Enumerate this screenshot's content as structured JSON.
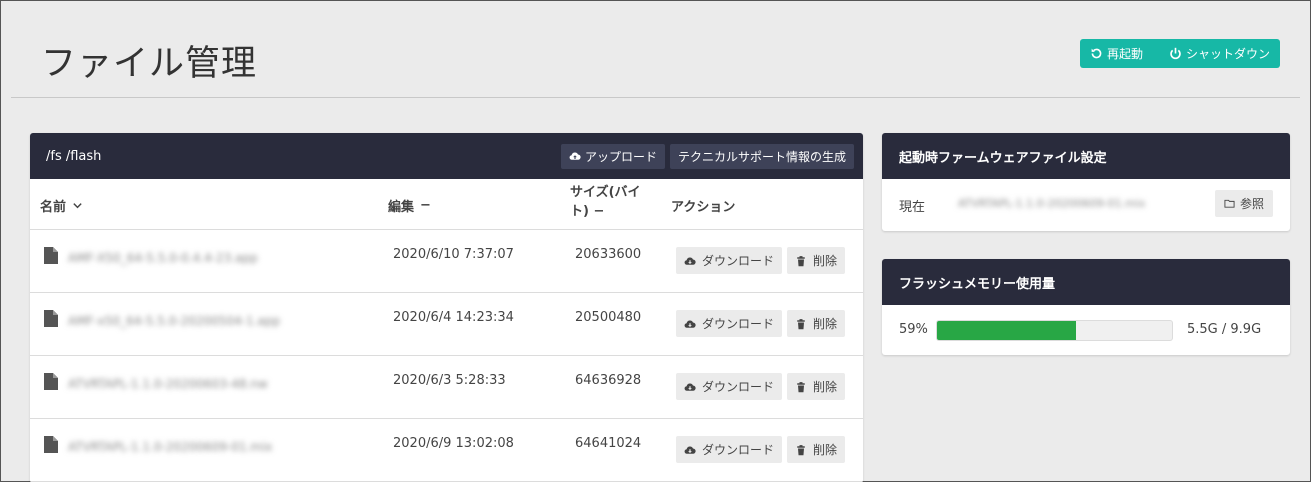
{
  "page": {
    "title": "ファイル管理"
  },
  "top_actions": {
    "restart_label": "再起動",
    "shutdown_label": "シャットダウン"
  },
  "files_panel": {
    "path": "/fs /flash",
    "upload_label": "アップロード",
    "tech_support_label": "テクニカルサポート情報の生成",
    "columns": {
      "name": "名前",
      "date": "編集",
      "size_line1": "サイズ(バイ",
      "size_line2": "ト)",
      "action": "アクション"
    },
    "sort_dash": "−",
    "download_label": "ダウンロード",
    "delete_label": "削除",
    "rows": [
      {
        "name": "AMF-X50_64-5.5.0-0.4.4-23.app",
        "date": "2020/6/10 7:37:07",
        "size": "20633600"
      },
      {
        "name": "AMF-x50_64-5.5.0-20200504-1.app",
        "date": "2020/6/4 14:23:34",
        "size": "20500480"
      },
      {
        "name": "ATVRTAPL-1.1.0-20200603-48.nw",
        "date": "2020/6/3 5:28:33",
        "size": "64636928"
      },
      {
        "name": "ATVRTAPL-1.1.0-20200609-01.mix",
        "date": "2020/6/9 13:02:08",
        "size": "64641024"
      }
    ]
  },
  "firmware_panel": {
    "title": "起動時ファームウェアファイル設定",
    "current_label": "現在",
    "current_value": "ATVRTAPL-1.1.0-20200609-01.mix",
    "browse_label": "参照"
  },
  "flash_panel": {
    "title": "フラッシュメモリー使用量",
    "percent_label": "59%",
    "percent_value": 0.59,
    "usage": "5.5G / 9.9G"
  },
  "colors": {
    "accent": "#17b8a6",
    "header_bg": "#292b3c",
    "progress": "#28a745"
  }
}
